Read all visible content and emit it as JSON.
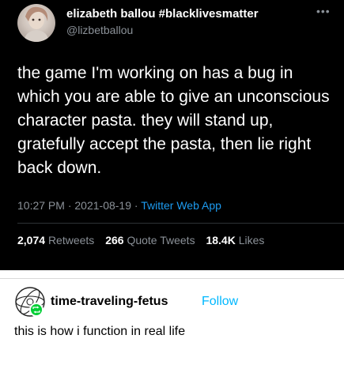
{
  "tweet": {
    "author_name": "elizabeth ballou #blacklivesmatter",
    "author_handle": "@lizbetballou",
    "more_icon": "more-horizontal-icon",
    "text": "the game I'm working on has a bug in which you are able to give an unconscious character pasta. they will stand up, gratefully accept the pasta, then lie right back down.",
    "time": "10:27 PM",
    "date": "2021-08-19",
    "separator": "·",
    "app": "Twitter Web App",
    "retweets_count": "2,074",
    "retweets_label": "Retweets",
    "quote_count": "266",
    "quote_label": "Quote Tweets",
    "likes_count": "18.4K",
    "likes_label": "Likes"
  },
  "reblog": {
    "blog_name": "time-traveling-fetus",
    "follow_label": "Follow",
    "text": "this is how i function in real life"
  },
  "colors": {
    "tweet_bg": "#000000",
    "secondary_text": "#8b9198",
    "twitter_blue": "#1d9bf0",
    "tumblr_follow": "#00b8ff",
    "reblog_green": "#00cf35"
  }
}
